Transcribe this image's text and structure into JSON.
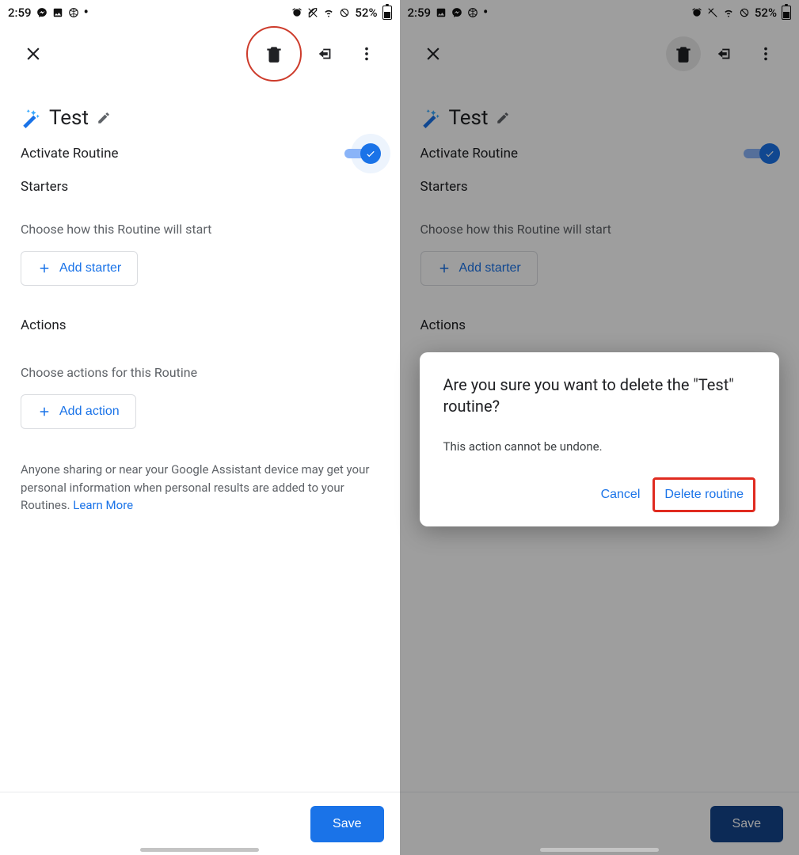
{
  "statusbar": {
    "time": "2:59",
    "battery_pct": "52%"
  },
  "appbar": {},
  "routine": {
    "name": "Test",
    "activate_label": "Activate Routine",
    "starters_head": "Starters",
    "starters_hint": "Choose how this Routine will start",
    "add_starter": "Add starter",
    "actions_head": "Actions",
    "actions_hint": "Choose actions for this Routine",
    "add_action": "Add action",
    "disclaimer": "Anyone sharing or near your Google Assistant device may get your personal information when personal results are added to your Routines. ",
    "learn_more": "Learn More"
  },
  "footer": {
    "save": "Save"
  },
  "dialog": {
    "title": "Are you sure you want to delete the \"Test\" routine?",
    "message": "This action cannot be undone.",
    "cancel": "Cancel",
    "confirm": "Delete routine"
  }
}
